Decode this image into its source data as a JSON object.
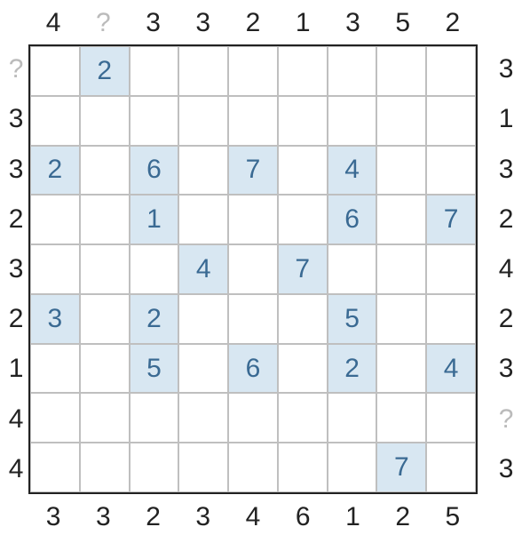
{
  "grid_size": 9,
  "clues": {
    "top": [
      "4",
      "?",
      "3",
      "3",
      "2",
      "1",
      "3",
      "5",
      "2"
    ],
    "bottom": [
      "3",
      "3",
      "2",
      "3",
      "4",
      "6",
      "1",
      "2",
      "5"
    ],
    "left": [
      "?",
      "3",
      "3",
      "2",
      "3",
      "2",
      "1",
      "4",
      "4"
    ],
    "right": [
      "3",
      "1",
      "3",
      "2",
      "4",
      "2",
      "3",
      "?",
      "3"
    ]
  },
  "cells": [
    [
      "",
      "2",
      "",
      "",
      "",
      "",
      "",
      "",
      ""
    ],
    [
      "",
      "",
      "",
      "",
      "",
      "",
      "",
      "",
      ""
    ],
    [
      "2",
      "",
      "6",
      "",
      "7",
      "",
      "4",
      "",
      ""
    ],
    [
      "",
      "",
      "1",
      "",
      "",
      "",
      "6",
      "",
      "7"
    ],
    [
      "",
      "",
      "",
      "4",
      "",
      "7",
      "",
      "",
      ""
    ],
    [
      "3",
      "",
      "2",
      "",
      "",
      "",
      "5",
      "",
      ""
    ],
    [
      "",
      "",
      "5",
      "",
      "6",
      "",
      "2",
      "",
      "4"
    ],
    [
      "",
      "",
      "",
      "",
      "",
      "",
      "",
      "",
      ""
    ],
    [
      "",
      "",
      "",
      "",
      "",
      "",
      "",
      "7",
      ""
    ]
  ],
  "chart_data": {
    "type": "table",
    "title": "Skyscrapers logic puzzle 9x9",
    "clues_top": [
      4,
      null,
      3,
      3,
      2,
      1,
      3,
      5,
      2
    ],
    "clues_bottom": [
      3,
      3,
      2,
      3,
      4,
      6,
      1,
      2,
      5
    ],
    "clues_left": [
      null,
      3,
      3,
      2,
      3,
      2,
      1,
      4,
      4
    ],
    "clues_right": [
      3,
      1,
      3,
      2,
      4,
      2,
      3,
      null,
      3
    ],
    "givens": [
      {
        "r": 0,
        "c": 1,
        "v": 2
      },
      {
        "r": 2,
        "c": 0,
        "v": 2
      },
      {
        "r": 2,
        "c": 2,
        "v": 6
      },
      {
        "r": 2,
        "c": 4,
        "v": 7
      },
      {
        "r": 2,
        "c": 6,
        "v": 4
      },
      {
        "r": 3,
        "c": 2,
        "v": 1
      },
      {
        "r": 3,
        "c": 6,
        "v": 6
      },
      {
        "r": 3,
        "c": 8,
        "v": 7
      },
      {
        "r": 4,
        "c": 3,
        "v": 4
      },
      {
        "r": 4,
        "c": 5,
        "v": 7
      },
      {
        "r": 5,
        "c": 0,
        "v": 3
      },
      {
        "r": 5,
        "c": 2,
        "v": 2
      },
      {
        "r": 5,
        "c": 6,
        "v": 5
      },
      {
        "r": 6,
        "c": 2,
        "v": 5
      },
      {
        "r": 6,
        "c": 4,
        "v": 6
      },
      {
        "r": 6,
        "c": 6,
        "v": 2
      },
      {
        "r": 6,
        "c": 8,
        "v": 4
      },
      {
        "r": 8,
        "c": 7,
        "v": 7
      }
    ]
  }
}
